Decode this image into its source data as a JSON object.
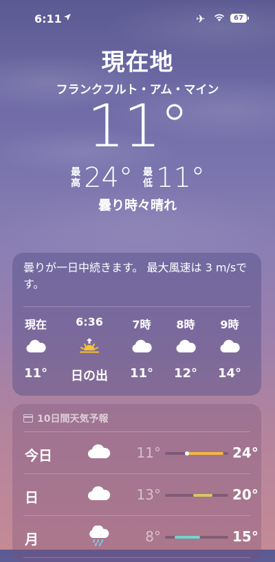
{
  "status_bar": {
    "time": "6:11",
    "battery": "67"
  },
  "header": {
    "place": "現在地",
    "city": "フランクフルト・アム・マイン",
    "temperature": "11°",
    "high_label": "最\n高",
    "high_value": "24°",
    "low_label": "最\n低",
    "low_value": "11°",
    "condition": "曇り時々晴れ"
  },
  "hourly": {
    "summary": "曇りが一日中続きます。 最大風速は 3 m/sです。",
    "items": [
      {
        "time": "現在",
        "icon": "cloud-icon",
        "temp": "11°"
      },
      {
        "time": "6:36",
        "icon": "sunrise-icon",
        "temp": "日の出"
      },
      {
        "time": "7時",
        "icon": "cloud-icon",
        "temp": "11°"
      },
      {
        "time": "8時",
        "icon": "cloud-icon",
        "temp": "12°"
      },
      {
        "time": "9時",
        "icon": "cloud-icon",
        "temp": "14°"
      }
    ]
  },
  "forecast": {
    "title": "10日間天気予報",
    "days": [
      {
        "day": "今日",
        "icon": "cloud-icon",
        "low": "11°",
        "high": "24°",
        "range": [
          0.35,
          0.92
        ],
        "current": 0.35,
        "color": "#f5b83a"
      },
      {
        "day": "日",
        "icon": "cloud-icon",
        "low": "13°",
        "high": "20°",
        "range": [
          0.45,
          0.75
        ],
        "color": "#d8c860"
      },
      {
        "day": "月",
        "icon": "cloud-rain-icon",
        "low": "8°",
        "high": "15°",
        "range": [
          0.15,
          0.55
        ],
        "color": "#6fd6d0"
      }
    ]
  },
  "colors": {
    "sun": "#f5c430"
  }
}
